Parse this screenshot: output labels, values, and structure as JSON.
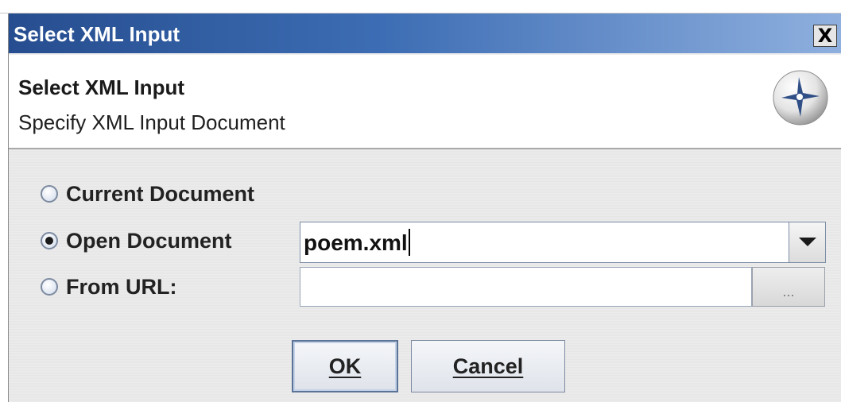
{
  "window": {
    "title": "Select XML Input",
    "close_label": "X"
  },
  "header": {
    "title": "Select XML Input",
    "subtitle": "Specify XML Input Document",
    "logo_icon": "cross-sphere-icon"
  },
  "options": [
    {
      "label": "Current Document",
      "selected": false
    },
    {
      "label": "Open Document",
      "selected": true
    },
    {
      "label": "From URL:",
      "selected": false
    }
  ],
  "open_document": {
    "value": "poem.xml"
  },
  "url": {
    "value": "",
    "browse_label": "..."
  },
  "buttons": {
    "ok": "OK",
    "cancel": "Cancel"
  },
  "colors": {
    "title_bar_start": "#264d8f",
    "title_bar_end": "#8fb0df"
  }
}
